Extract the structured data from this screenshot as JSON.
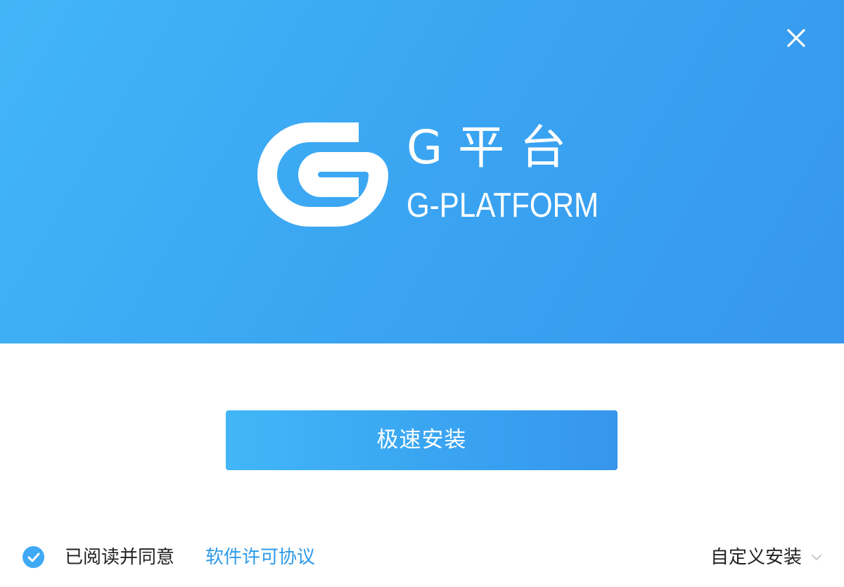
{
  "window": {
    "close_icon": "close-icon"
  },
  "brand": {
    "name_cn": "G平台",
    "name_en": "G-PLATFORM",
    "logo_icon": "g-logo-icon",
    "accent_color": "#3aa5f2"
  },
  "install": {
    "button_label": "极速安装"
  },
  "footer": {
    "agree_checked": true,
    "agree_text": "已阅读并同意",
    "license_link": "软件许可协议",
    "custom_install_label": "自定义安装",
    "custom_install_icon": "chevron-down-icon"
  }
}
